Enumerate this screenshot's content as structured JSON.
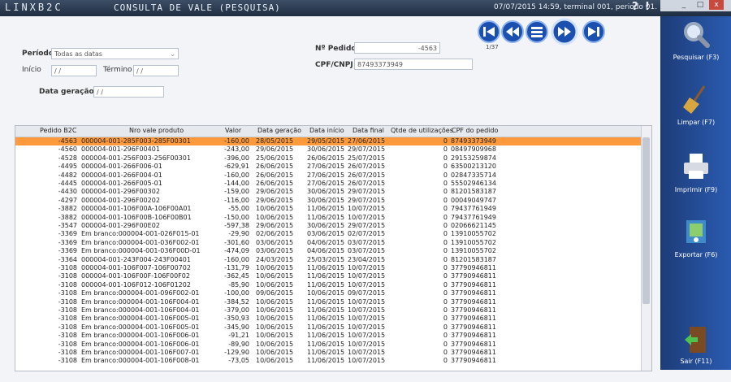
{
  "titlebar": {
    "brand": "LINXB2C",
    "window_title": "CONSULTA DE VALE (PESQUISA)",
    "status": "07/07/2015 14:59, terminal 001, periodo 01.",
    "help_glyph": "?",
    "info_glyph": "!"
  },
  "window_controls": {
    "minimize": "_",
    "maximize": "□",
    "close": "x"
  },
  "filters": {
    "periodo_label": "Período",
    "periodo_value": "Todas as datas",
    "inicio_label": "Início",
    "inicio_value": "/ /",
    "termino_label": "Término",
    "termino_value": "/ /",
    "data_geracao_label": "Data geração",
    "data_geracao_value": "/ /",
    "pedido_label": "Nº Pedido",
    "pedido_value": "-4563",
    "cpf_label": "CPF/CNPJ",
    "cpf_value": "87493373949"
  },
  "pager": {
    "text": "1/37"
  },
  "sidebar": {
    "pesquisar": "Pesquisar (F3)",
    "limpar": "Limpar (F7)",
    "imprimir": "Imprimir (F9)",
    "exportar": "Exportar (F6)",
    "sair": "Sair (F11)"
  },
  "grid": {
    "columns": [
      "Pedido B2C",
      "Nro vale produto",
      "Valor",
      "Data geração",
      "Data início",
      "Data final",
      "Qtde de utilizações",
      "CPF do pedido"
    ],
    "rows": [
      [
        "-4563",
        "000004-001-285F003-285F00301",
        "-160,00",
        "28/05/2015",
        "29/05/2015",
        "27/06/2015",
        "0",
        "87493373949"
      ],
      [
        "-4560",
        "000004-001-296F00401",
        "-243,00",
        "29/06/2015",
        "30/06/2015",
        "29/07/2015",
        "0",
        "08497909968"
      ],
      [
        "-4528",
        "000004-001-256F003-256F00301",
        "-396,00",
        "25/06/2015",
        "26/06/2015",
        "25/07/2015",
        "0",
        "29153259874"
      ],
      [
        "-4495",
        "000004-001-266F006-01",
        "-629,91",
        "26/06/2015",
        "27/06/2015",
        "26/07/2015",
        "0",
        "63500213120"
      ],
      [
        "-4482",
        "000004-001-266F004-01",
        "-160,00",
        "26/06/2015",
        "27/06/2015",
        "26/07/2015",
        "0",
        "02847335714"
      ],
      [
        "-4445",
        "000004-001-266F005-01",
        "-144,00",
        "26/06/2015",
        "27/06/2015",
        "26/07/2015",
        "0",
        "55502946134"
      ],
      [
        "-4430",
        "000004-001-296F00302",
        "-159,00",
        "29/06/2015",
        "30/06/2015",
        "29/07/2015",
        "0",
        "81201583187"
      ],
      [
        "-4297",
        "000004-001-296F00202",
        "-116,00",
        "29/06/2015",
        "30/06/2015",
        "29/07/2015",
        "0",
        "00049049747"
      ],
      [
        "-3882",
        "000004-001-106F00A-106F00A01",
        "-55,00",
        "10/06/2015",
        "11/06/2015",
        "10/07/2015",
        "0",
        "79437761949"
      ],
      [
        "-3882",
        "000004-001-106F00B-106F00B01",
        "-150,00",
        "10/06/2015",
        "11/06/2015",
        "10/07/2015",
        "0",
        "79437761949"
      ],
      [
        "-3547",
        "000004-001-296F00E02",
        "-597,38",
        "29/06/2015",
        "30/06/2015",
        "29/07/2015",
        "0",
        "02066621145"
      ],
      [
        "-3369",
        "Em branco:000004-001-026F015-01",
        "-29,90",
        "02/06/2015",
        "03/06/2015",
        "02/07/2015",
        "0",
        "13910055702"
      ],
      [
        "-3369",
        "Em branco:000004-001-036F002-01",
        "-301,60",
        "03/06/2015",
        "04/06/2015",
        "03/07/2015",
        "0",
        "13910055702"
      ],
      [
        "-3369",
        "Em branco:000004-001-036F00D-01",
        "-474,09",
        "03/06/2015",
        "04/06/2015",
        "03/07/2015",
        "0",
        "13910055702"
      ],
      [
        "-3364",
        "000004-001-243F004-243F00401",
        "-160,00",
        "24/03/2015",
        "25/03/2015",
        "23/04/2015",
        "0",
        "81201583187"
      ],
      [
        "-3108",
        "000004-001-106F007-106F00702",
        "-131,79",
        "10/06/2015",
        "11/06/2015",
        "10/07/2015",
        "0",
        "37790946811"
      ],
      [
        "-3108",
        "000004-001-106F00F-106F00F02",
        "-362,45",
        "10/06/2015",
        "11/06/2015",
        "10/07/2015",
        "0",
        "37790946811"
      ],
      [
        "-3108",
        "000004-001-106F012-106F01202",
        "-85,90",
        "10/06/2015",
        "11/06/2015",
        "10/07/2015",
        "0",
        "37790946811"
      ],
      [
        "-3108",
        "Em branco:000004-001-096F002-01",
        "-100,00",
        "09/06/2015",
        "10/06/2015",
        "09/07/2015",
        "0",
        "37790946811"
      ],
      [
        "-3108",
        "Em branco:000004-001-106F004-01",
        "-384,52",
        "10/06/2015",
        "11/06/2015",
        "10/07/2015",
        "0",
        "37790946811"
      ],
      [
        "-3108",
        "Em branco:000004-001-106F004-01",
        "-379,00",
        "10/06/2015",
        "11/06/2015",
        "10/07/2015",
        "0",
        "37790946811"
      ],
      [
        "-3108",
        "Em branco:000004-001-106F005-01",
        "-350,93",
        "10/06/2015",
        "11/06/2015",
        "10/07/2015",
        "0",
        "37790946811"
      ],
      [
        "-3108",
        "Em branco:000004-001-106F005-01",
        "-345,90",
        "10/06/2015",
        "11/06/2015",
        "10/07/2015",
        "0",
        "37790946811"
      ],
      [
        "-3108",
        "Em branco:000004-001-106F006-01",
        "-91,21",
        "10/06/2015",
        "11/06/2015",
        "10/07/2015",
        "0",
        "37790946811"
      ],
      [
        "-3108",
        "Em branco:000004-001-106F006-01",
        "-89,90",
        "10/06/2015",
        "11/06/2015",
        "10/07/2015",
        "0",
        "37790946811"
      ],
      [
        "-3108",
        "Em branco:000004-001-106F007-01",
        "-129,90",
        "10/06/2015",
        "11/06/2015",
        "10/07/2015",
        "0",
        "37790946811"
      ],
      [
        "-3108",
        "Em branco:000004-001-106F008-01",
        "-73,05",
        "10/06/2015",
        "11/06/2015",
        "10/07/2015",
        "0",
        "37790946811"
      ]
    ]
  }
}
